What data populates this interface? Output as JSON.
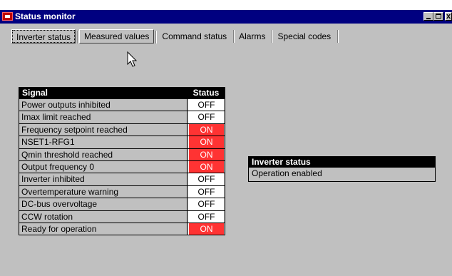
{
  "window": {
    "title": "Status monitor",
    "min_icon": "minimize-icon",
    "max_icon": "maximize-icon",
    "close_icon": "close-icon",
    "close_glyph": "x"
  },
  "tabs": [
    {
      "label": "Inverter status",
      "selected": true
    },
    {
      "label": "Measured values",
      "selected": false
    },
    {
      "label": "Command status",
      "selected": false
    },
    {
      "label": "Alarms",
      "selected": false
    },
    {
      "label": "Special codes",
      "selected": false
    }
  ],
  "signal_table": {
    "headers": {
      "signal": "Signal",
      "status": "Status"
    },
    "rows": [
      {
        "signal": "Power outputs inhibited",
        "status": "OFF"
      },
      {
        "signal": "Imax limit reached",
        "status": "OFF"
      },
      {
        "signal": "Frequency setpoint reached",
        "status": "ON"
      },
      {
        "signal": "NSET1-RFG1",
        "status": "ON"
      },
      {
        "signal": "Qmin threshold reached",
        "status": "ON"
      },
      {
        "signal": "Output frequency 0",
        "status": "ON"
      },
      {
        "signal": "Inverter inhibited",
        "status": "OFF"
      },
      {
        "signal": "Overtemperature warning",
        "status": "OFF"
      },
      {
        "signal": "DC-bus overvoltage",
        "status": "OFF"
      },
      {
        "signal": "CCW rotation",
        "status": "OFF"
      },
      {
        "signal": "Ready for operation",
        "status": "ON"
      }
    ]
  },
  "inverter_status": {
    "title": "Inverter status",
    "value": "Operation enabled"
  },
  "colors": {
    "titlebar": "#000080",
    "window_bg": "#c0c0c0",
    "on": "#ff3333",
    "off": "#ffffff"
  }
}
